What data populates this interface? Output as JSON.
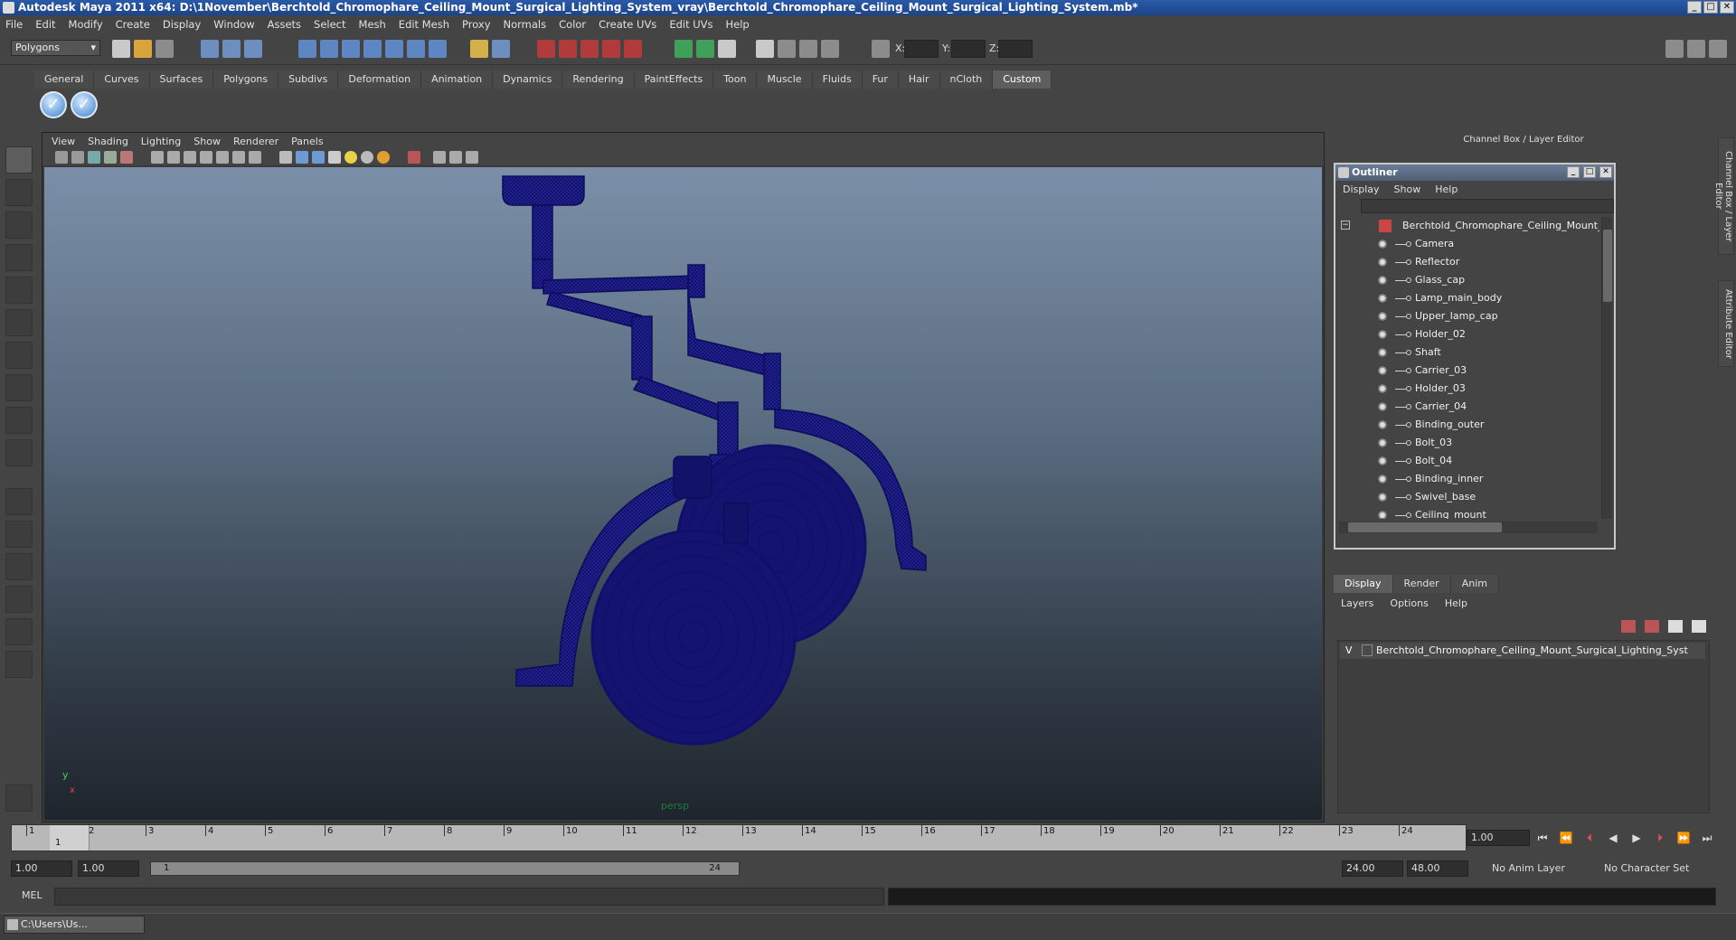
{
  "window": {
    "title": "Autodesk Maya 2011 x64: D:\\1November\\Berchtold_Chromophare_Ceiling_Mount_Surgical_Lighting_System_vray\\Berchtold_Chromophare_Ceiling_Mount_Surgical_Lighting_System.mb*",
    "min": "_",
    "max": "□",
    "close": "✕"
  },
  "menubar": [
    "File",
    "Edit",
    "Modify",
    "Create",
    "Display",
    "Window",
    "Assets",
    "Select",
    "Mesh",
    "Edit Mesh",
    "Proxy",
    "Normals",
    "Color",
    "Create UVs",
    "Edit UVs",
    "Help"
  ],
  "statusline": {
    "mode": "Polygons",
    "x_label": "X:",
    "y_label": "Y:",
    "z_label": "Z:"
  },
  "shelf": {
    "tabs": [
      "General",
      "Curves",
      "Surfaces",
      "Polygons",
      "Subdivs",
      "Deformation",
      "Animation",
      "Dynamics",
      "Rendering",
      "PaintEffects",
      "Toon",
      "Muscle",
      "Fluids",
      "Fur",
      "Hair",
      "nCloth",
      "Custom"
    ],
    "active_tab": "Custom",
    "buttons": [
      "✓",
      "✓"
    ]
  },
  "viewport": {
    "menu": [
      "View",
      "Shading",
      "Lighting",
      "Show",
      "Renderer",
      "Panels"
    ],
    "camera_label": "persp",
    "axis_y": "y",
    "axis_x": "x",
    "wire_color": "#1a1a7a"
  },
  "right_panel": {
    "title": "Channel Box / Layer Editor",
    "side_tabs": [
      "Channel Box / Layer Editor",
      "Attribute Editor"
    ]
  },
  "outliner": {
    "title": "Outliner",
    "menu": [
      "Display",
      "Show",
      "Help"
    ],
    "root": "Berchtold_Chromophare_Ceiling_Mount_Surgi",
    "items": [
      "Camera",
      "Reflector",
      "Glass_cap",
      "Lamp_main_body",
      "Upper_lamp_cap",
      "Holder_02",
      "Shaft",
      "Carrier_03",
      "Holder_03",
      "Carrier_04",
      "Binding_outer",
      "Bolt_03",
      "Bolt_04",
      "Binding_inner",
      "Swivel_base",
      "Ceiling_mount"
    ]
  },
  "layer_editor": {
    "tabs": [
      "Display",
      "Render",
      "Anim"
    ],
    "active_tab": "Display",
    "menu": [
      "Layers",
      "Options",
      "Help"
    ],
    "layer_visible": "V",
    "layer_name": "Berchtold_Chromophare_Ceiling_Mount_Surgical_Lighting_Syst"
  },
  "timeline": {
    "ticks": [
      "1",
      "2",
      "3",
      "4",
      "5",
      "6",
      "7",
      "8",
      "9",
      "10",
      "11",
      "12",
      "13",
      "14",
      "15",
      "16",
      "17",
      "18",
      "19",
      "20",
      "21",
      "22",
      "23",
      "24"
    ],
    "current_frame_marker": "1",
    "current_frame": "1.00"
  },
  "range": {
    "start": "1.00",
    "playback_start": "1.00",
    "slider_start": "1",
    "slider_end": "24",
    "playback_end": "24.00",
    "end": "48.00",
    "anim_layer": "No Anim Layer",
    "character_set": "No Character Set"
  },
  "command_line": {
    "label": "MEL"
  },
  "taskbar": {
    "item": "C:\\Users\\Us..."
  }
}
